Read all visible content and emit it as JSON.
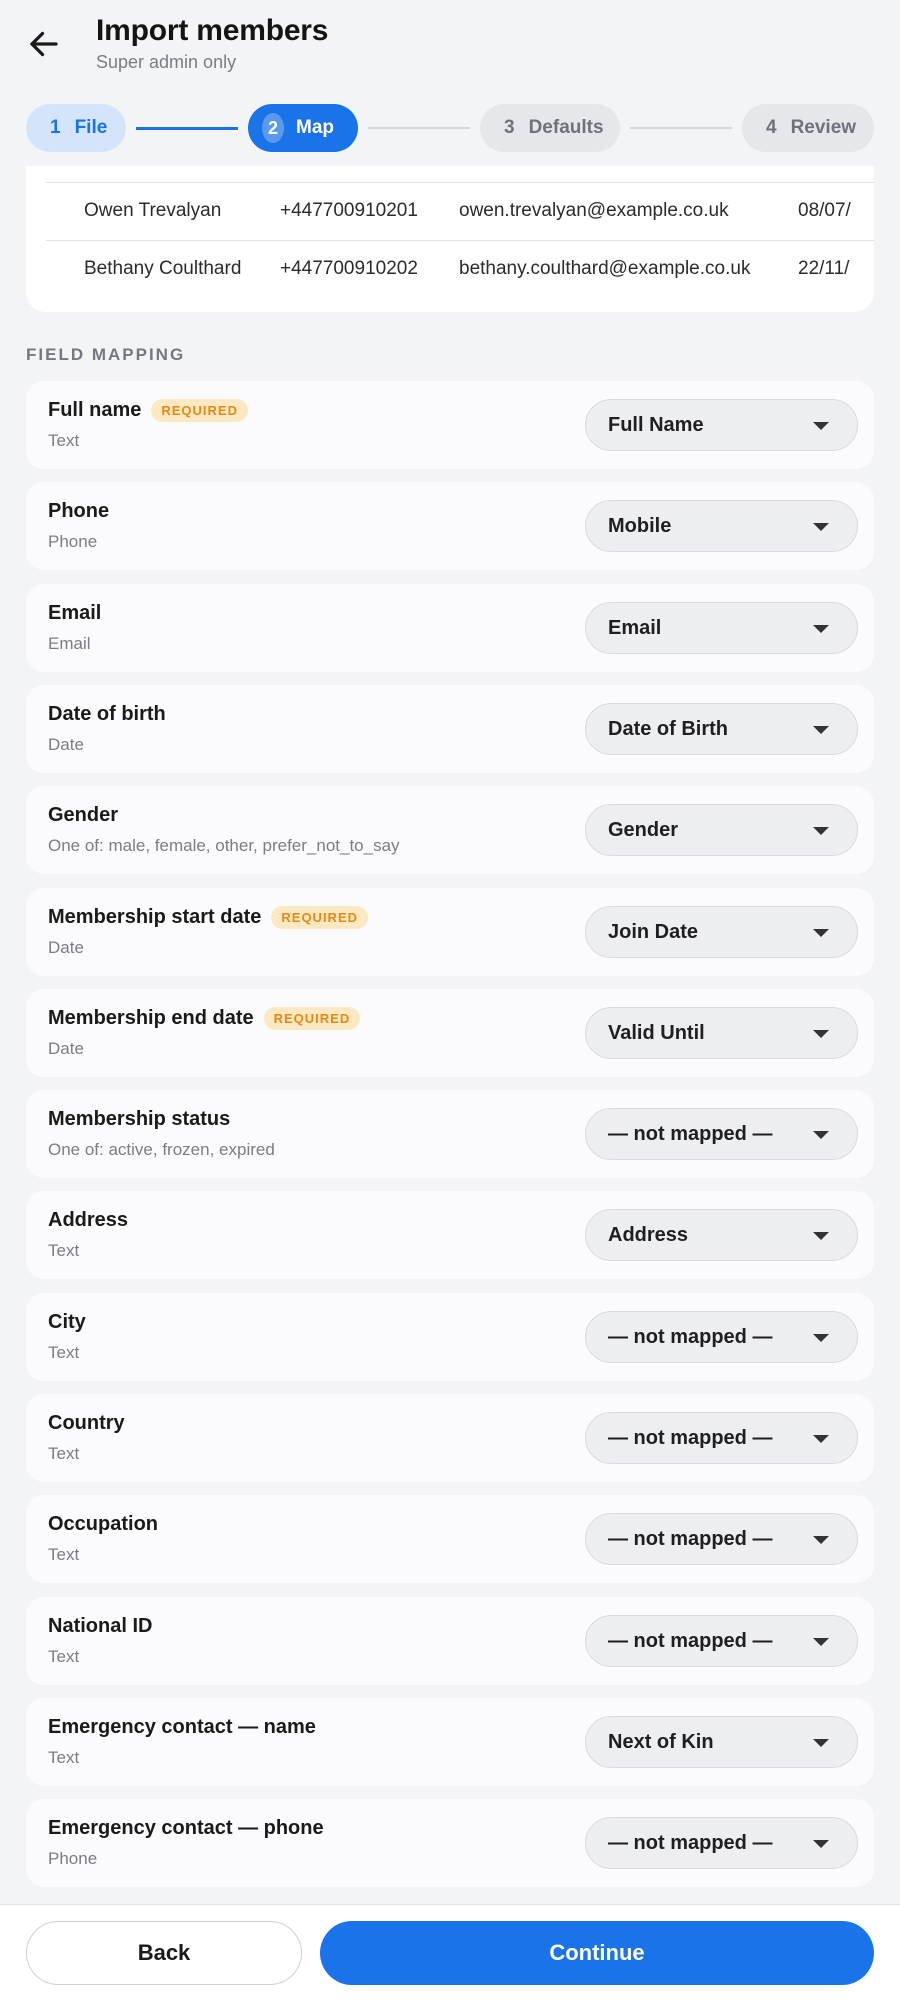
{
  "header": {
    "title": "Import members",
    "subtitle": "Super admin only",
    "back_icon": "arrow-left-icon"
  },
  "stepper": [
    {
      "num": "1",
      "label": "File",
      "state": "done"
    },
    {
      "num": "2",
      "label": "Map",
      "state": "active"
    },
    {
      "num": "3",
      "label": "Defaults",
      "state": "todo"
    },
    {
      "num": "4",
      "label": "Review",
      "state": "todo"
    }
  ],
  "preview_rows": [
    {
      "name": "Owen Trevalyan",
      "phone": "+447700910201",
      "email": "owen.trevalyan@example.co.uk",
      "date": "08/07/"
    },
    {
      "name": "Bethany Coulthard",
      "phone": "+447700910202",
      "email": "bethany.coulthard@example.co.uk",
      "date": "22/11/"
    }
  ],
  "section_label": "FIELD MAPPING",
  "required_label": "REQUIRED",
  "fields": [
    {
      "name": "Full name",
      "type": "Text",
      "required": true,
      "mapped": "Full Name"
    },
    {
      "name": "Phone",
      "type": "Phone",
      "required": false,
      "mapped": "Mobile"
    },
    {
      "name": "Email",
      "type": "Email",
      "required": false,
      "mapped": "Email"
    },
    {
      "name": "Date of birth",
      "type": "Date",
      "required": false,
      "mapped": "Date of Birth"
    },
    {
      "name": "Gender",
      "type": "One of: male, female, other, prefer_not_to_say",
      "required": false,
      "mapped": "Gender"
    },
    {
      "name": "Membership start date",
      "type": "Date",
      "required": true,
      "mapped": "Join Date"
    },
    {
      "name": "Membership end date",
      "type": "Date",
      "required": true,
      "mapped": "Valid Until"
    },
    {
      "name": "Membership status",
      "type": "One of: active, frozen, expired",
      "required": false,
      "mapped": "— not mapped —"
    },
    {
      "name": "Address",
      "type": "Text",
      "required": false,
      "mapped": "Address"
    },
    {
      "name": "City",
      "type": "Text",
      "required": false,
      "mapped": "— not mapped —"
    },
    {
      "name": "Country",
      "type": "Text",
      "required": false,
      "mapped": "— not mapped —"
    },
    {
      "name": "Occupation",
      "type": "Text",
      "required": false,
      "mapped": "— not mapped —"
    },
    {
      "name": "National ID",
      "type": "Text",
      "required": false,
      "mapped": "— not mapped —"
    },
    {
      "name": "Emergency contact — name",
      "type": "Text",
      "required": false,
      "mapped": "Next of Kin"
    },
    {
      "name": "Emergency contact — phone",
      "type": "Phone",
      "required": false,
      "mapped": "— not mapped —"
    }
  ],
  "footer": {
    "back_label": "Back",
    "continue_label": "Continue"
  },
  "colors": {
    "accent": "#1a73e8",
    "required_badge_bg": "#fde8c4",
    "required_badge_text": "#e88a12"
  }
}
